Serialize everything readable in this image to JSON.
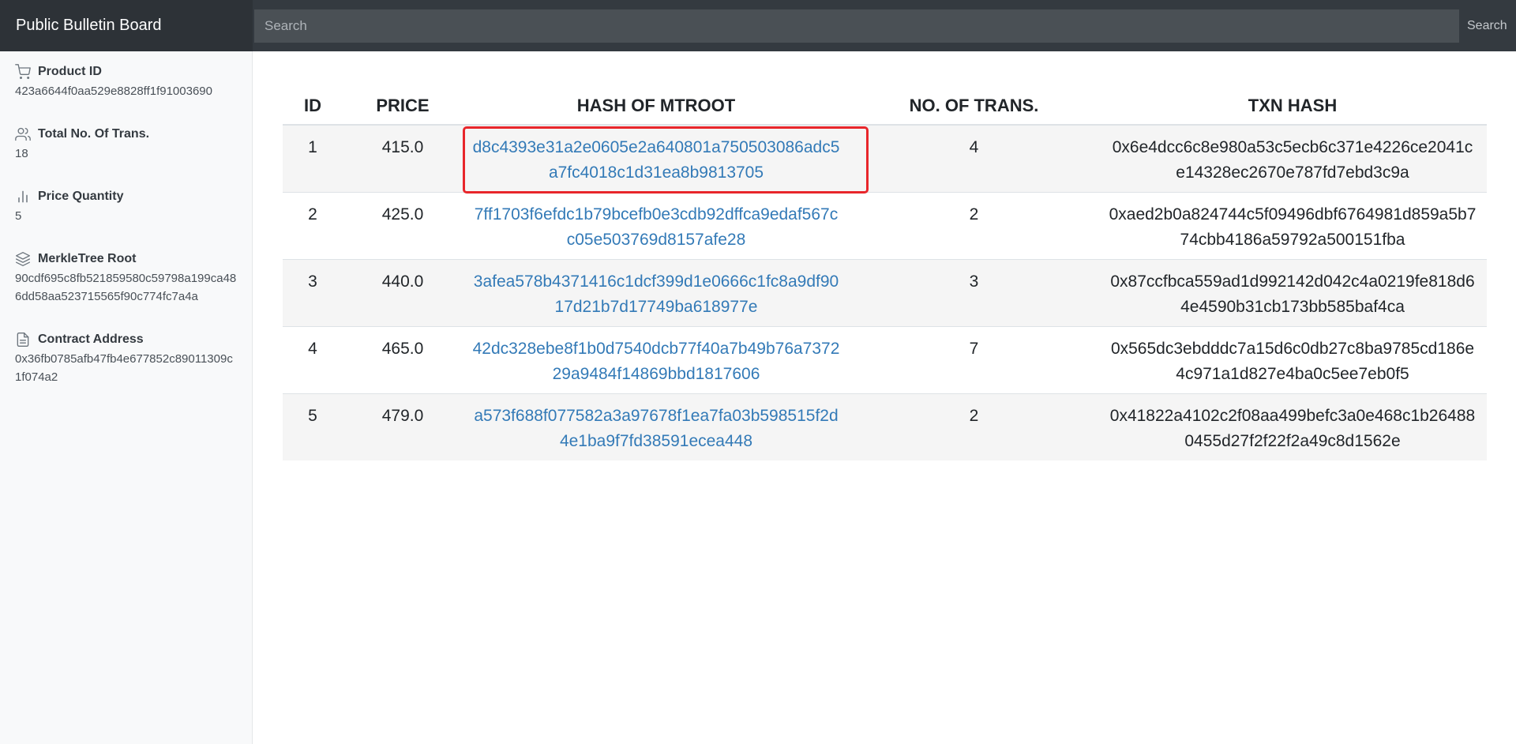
{
  "navbar": {
    "brand": "Public Bulletin Board",
    "search_placeholder": "Search",
    "search_button": "Search"
  },
  "sidebar": {
    "items": [
      {
        "icon": "cart-icon",
        "label": "Product ID",
        "value": "423a6644f0aa529e8828ff1f91003690"
      },
      {
        "icon": "users-icon",
        "label": "Total No. Of Trans.",
        "value": "18"
      },
      {
        "icon": "bar-chart-icon",
        "label": "Price Quantity",
        "value": "5"
      },
      {
        "icon": "layers-icon",
        "label": "MerkleTree Root",
        "value": "90cdf695c8fb521859580c59798a199ca486dd58aa523715565f90c774fc7a4a"
      },
      {
        "icon": "file-icon",
        "label": "Contract Address",
        "value": "0x36fb0785afb47fb4e677852c89011309c1f074a2"
      }
    ]
  },
  "table": {
    "headers": [
      "ID",
      "PRICE",
      "HASH OF MTROOT",
      "NO. OF TRANS.",
      "TXN HASH"
    ],
    "rows": [
      {
        "id": "1",
        "price": "415.0",
        "mtroot": "d8c4393e31a2e0605e2a640801a750503086adc5a7fc4018c1d31ea8b9813705",
        "trans": "4",
        "txn": "0x6e4dcc6c8e980a53c5ecb6c371e4226ce2041ce14328ec2670e787fd7ebd3c9a"
      },
      {
        "id": "2",
        "price": "425.0",
        "mtroot": "7ff1703f6efdc1b79bcefb0e3cdb92dffca9edaf567cc05e503769d8157afe28",
        "trans": "2",
        "txn": "0xaed2b0a824744c5f09496dbf6764981d859a5b774cbb4186a59792a500151fba"
      },
      {
        "id": "3",
        "price": "440.0",
        "mtroot": "3afea578b4371416c1dcf399d1e0666c1fc8a9df9017d21b7d17749ba618977e",
        "trans": "3",
        "txn": "0x87ccfbca559ad1d992142d042c4a0219fe818d64e4590b31cb173bb585baf4ca"
      },
      {
        "id": "4",
        "price": "465.0",
        "mtroot": "42dc328ebe8f1b0d7540dcb77f40a7b49b76a737229a9484f14869bbd1817606",
        "trans": "7",
        "txn": "0x565dc3ebdddc7a15d6c0db27c8ba9785cd186e4c971a1d827e4ba0c5ee7eb0f5"
      },
      {
        "id": "5",
        "price": "479.0",
        "mtroot": "a573f688f077582a3a97678f1ea7fa03b598515f2d4e1ba9f7fd38591ecea448",
        "trans": "2",
        "txn": "0x41822a4102c2f08aa499befc3a0e468c1b264880455d27f2f22f2a49c8d1562e"
      }
    ]
  },
  "colors": {
    "navbar": "#343a40",
    "link": "#337ab7",
    "highlight": "#e8262b",
    "stripe": "#f5f5f5"
  }
}
